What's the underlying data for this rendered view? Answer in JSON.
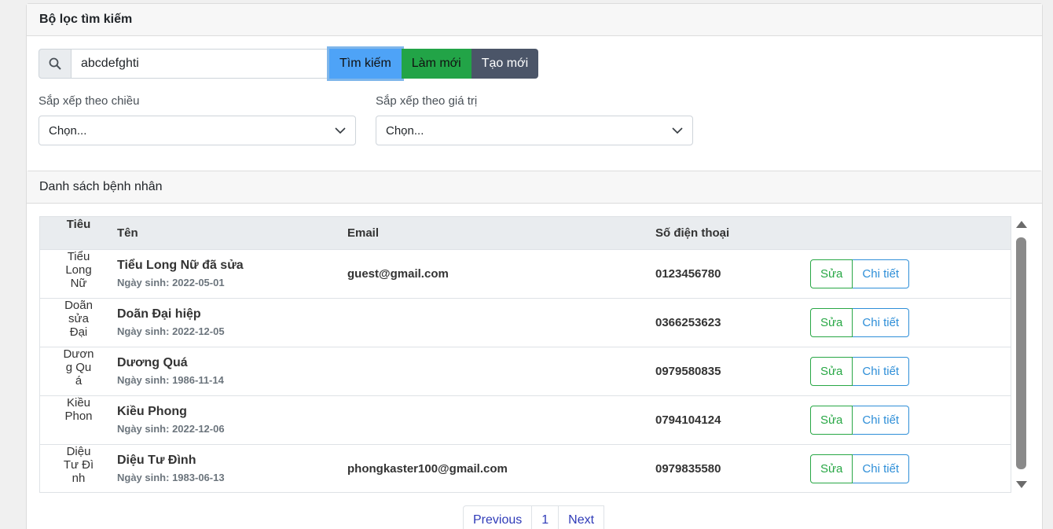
{
  "filter": {
    "title": "Bộ lọc tìm kiếm",
    "search_value": "abcdefghti",
    "search_btn": "Tìm kiếm",
    "refresh_btn": "Làm mới",
    "new_btn": "Tạo mới",
    "sort_direction_label": "Sắp xếp theo chiều",
    "sort_direction_value": "Chọn...",
    "sort_value_label": "Sắp xếp theo giá trị",
    "sort_value_value": "Chọn..."
  },
  "list": {
    "title": "Danh sách bệnh nhân",
    "headers": {
      "image": "Tiêu",
      "name": "Tên",
      "email": "Email",
      "phone": "Số điện thoại"
    },
    "rows": [
      {
        "img_alt": "Tiểu Long Nữ",
        "name": "Tiểu Long Nữ đã sửa",
        "dob": "Ngày sinh: 2022-05-01",
        "email": "guest@gmail.com",
        "phone": "0123456780",
        "edit": "Sửa",
        "detail": "Chi tiết"
      },
      {
        "img_alt": "Doãn sửa Đại",
        "name": "Doãn Đại hiệp",
        "dob": "Ngày sinh: 2022-12-05",
        "email": "",
        "phone": "0366253623",
        "edit": "Sửa",
        "detail": "Chi tiết"
      },
      {
        "img_alt": "Dương Quá",
        "name": "Dương Quá",
        "dob": "Ngày sinh: 1986-11-14",
        "email": "",
        "phone": "0979580835",
        "edit": "Sửa",
        "detail": "Chi tiết"
      },
      {
        "img_alt": "Kiều Phon",
        "name": "Kiều Phong",
        "dob": "Ngày sinh: 2022-12-06",
        "email": "",
        "phone": "0794104124",
        "edit": "Sửa",
        "detail": "Chi tiết"
      },
      {
        "img_alt": "Diệu Tư Đình",
        "name": "Diệu Tư Đình",
        "dob": "Ngày sinh: 1983-06-13",
        "email": "phongkaster100@gmail.com",
        "phone": "0979835580",
        "edit": "Sửa",
        "detail": "Chi tiết"
      }
    ]
  },
  "pagination": {
    "prev": "Previous",
    "page": "1",
    "next": "Next"
  },
  "icons": {
    "search": "search-icon",
    "dropdown": "chevron-down-icon"
  },
  "colors": {
    "search_btn": "#4ea3f7",
    "refresh_btn": "#22a447",
    "new_btn": "#4b5568",
    "edit": "#28a745",
    "detail": "#2f8fd8"
  }
}
